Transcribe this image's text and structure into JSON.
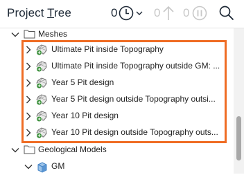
{
  "header": {
    "title_prefix": "Project ",
    "title_underlined": "T",
    "title_suffix": "ree",
    "history_count": "0",
    "sync_count": "0",
    "pause_count": "0"
  },
  "tree": {
    "meshes_label": "Meshes",
    "mesh_items": [
      {
        "label": "Ultimate Pit inside Topography"
      },
      {
        "label": "Ultimate Pit inside Topography outside GM: ..."
      },
      {
        "label": "Year 5 Pit design"
      },
      {
        "label": "Year 5 Pit design outside Topography outsi..."
      },
      {
        "label": "Year 10 Pit design"
      },
      {
        "label": "Year 10 Pit design outside Topography outs..."
      }
    ],
    "geological_models_label": "Geological Models",
    "gm_label": "GM"
  },
  "colors": {
    "highlight": "#ef6c24",
    "title": "#1f2a37",
    "mesh_icon_green": "#3a8f3a",
    "gm_icon_blue": "#3d7fc4"
  }
}
